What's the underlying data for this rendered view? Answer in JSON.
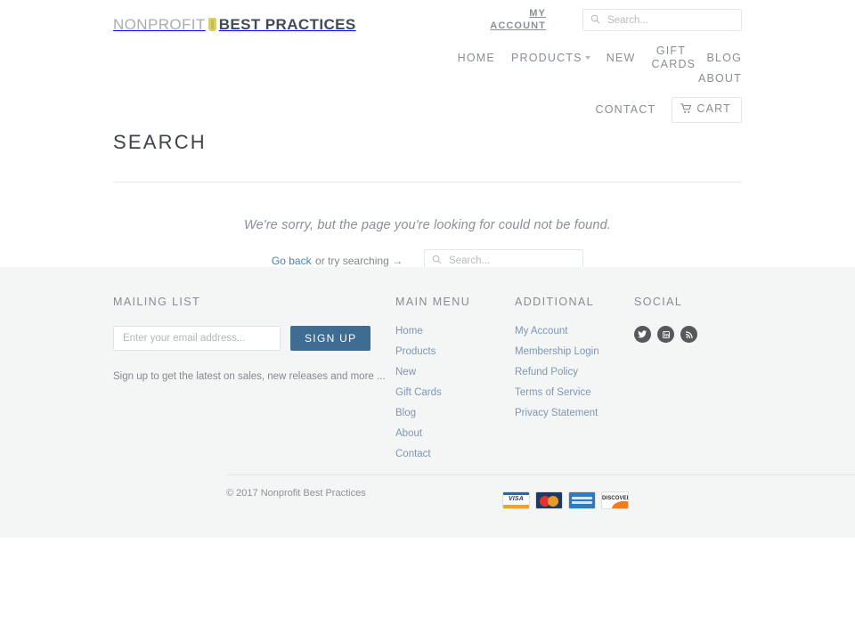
{
  "brand": {
    "name_light": "NONPROFIT",
    "name_bold": "BEST PRACTICES",
    "mark_icon": "bookmark-icon"
  },
  "header": {
    "my_account": "MY\nACCOUNT",
    "my_account_line1": "MY",
    "my_account_line2": "ACCOUNT",
    "search": {
      "placeholder": "Search...",
      "value": "",
      "icon": "search-icon"
    },
    "nav": [
      {
        "label": "HOME",
        "has_dropdown": false
      },
      {
        "label": "PRODUCTS",
        "has_dropdown": true
      },
      {
        "label": "NEW",
        "has_dropdown": false
      },
      {
        "label": "GIFT CARDS",
        "has_dropdown": false,
        "line1": "GIFT",
        "line2": "CARDS"
      },
      {
        "label": "BLOG",
        "has_dropdown": false
      },
      {
        "label": "ABOUT",
        "has_dropdown": false
      },
      {
        "label": "CONTACT",
        "has_dropdown": false
      }
    ],
    "cart": {
      "label": "CART",
      "icon": "shopping-cart-icon"
    }
  },
  "main": {
    "title": "SEARCH",
    "error_message": "We're sorry, but the page you're looking for could not be found.",
    "go_back_label": "Go back",
    "try_searching_label": "or try searching →",
    "search": {
      "placeholder": "Search...",
      "value": "",
      "icon": "search-icon"
    }
  },
  "footer": {
    "mailing": {
      "heading": "MAILING LIST",
      "input_placeholder": "Enter your email address...",
      "input_value": "",
      "button_label": "SIGN UP",
      "note": "Sign up to get the latest on sales, new releases and more ..."
    },
    "main_menu": {
      "heading": "MAIN MENU",
      "links": [
        "Home",
        "Products",
        "New",
        "Gift Cards",
        "Blog",
        "About",
        "Contact"
      ]
    },
    "additional": {
      "heading": "ADDITIONAL",
      "links": [
        "My Account",
        "Membership Login",
        "Refund Policy",
        "Terms of Service",
        "Privacy Statement"
      ]
    },
    "social": {
      "heading": "SOCIAL",
      "icons": [
        "twitter-icon",
        "linkedin-icon",
        "rss-icon"
      ]
    },
    "copyright": "© 2017 Nonprofit Best Practices",
    "payment_cards": [
      "VISA",
      "MasterCard",
      "American Express",
      "Discover"
    ]
  },
  "colors": {
    "accent_button": "#3e6c92",
    "link": "#7f97b3",
    "brand_dark": "#3f4b57",
    "brand_mark": "#d8cf6a",
    "footer_bg": "#f4f5f5",
    "muted_text": "#888e96"
  }
}
